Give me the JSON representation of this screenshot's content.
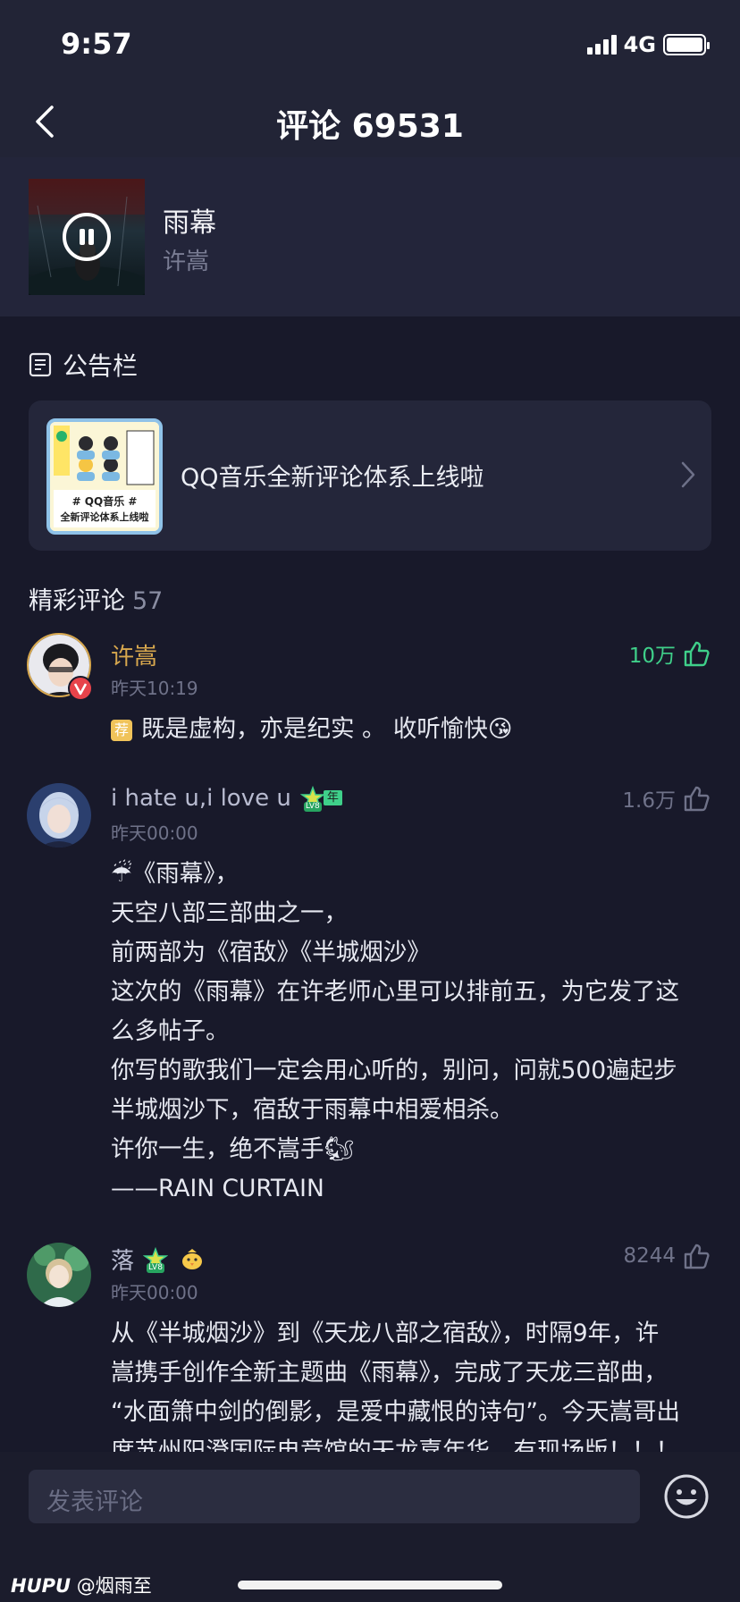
{
  "status_bar": {
    "time": "9:57",
    "network": "4G",
    "battery_level": 1.0
  },
  "nav": {
    "title": "评论 69531"
  },
  "song": {
    "title": "雨幕",
    "artist": "许嵩",
    "is_playing": true
  },
  "notice": {
    "heading": "公告栏",
    "card_text": "QQ音乐全新评论体系上线啦",
    "thumb_caption_1": "# QQ音乐 #",
    "thumb_caption_2": "全新评论体系上线啦"
  },
  "section": {
    "title": "精彩评论",
    "count": "57"
  },
  "comments": [
    {
      "author": "许嵩",
      "time": "昨天10:19",
      "likes": "10万",
      "liked": true,
      "verified_badge": "V",
      "tag": "荐",
      "lines": [
        "既是虚构，亦是纪实 。 收听愉快😘"
      ]
    },
    {
      "author": "i hate u,i love u",
      "level_badge": "LV8",
      "year_badge": "年",
      "time": "昨天00:00",
      "likes": "1.6万",
      "liked": false,
      "lines": [
        "☔《雨幕》，",
        "天空八部三部曲之一，",
        "前两部为《宿敌》《半城烟沙》",
        "这次的《雨幕》在许老师心里可以排前五，为它发了这",
        "么多帖子。",
        "你写的歌我们一定会用心听的，别问，问就500遍起步",
        "半城烟沙下，宿敌于雨幕中相爱相杀。",
        "许你一生，绝不嵩手🐿",
        "——RAIN CURTAIN"
      ]
    },
    {
      "author": "落",
      "level_badge": "LV8",
      "time": "昨天00:00",
      "likes": "8244",
      "liked": false,
      "lines": [
        "从《半城烟沙》到《天龙八部之宿敌》，时隔9年，许",
        "嵩携手创作全新主题曲《雨幕》，完成了天龙三部曲，",
        "“水面箫中剑的倒影，是爱中藏恨的诗句”。今天嵩哥出",
        "席苏州阳澄国际电竞馆的天龙嘉年华，有现场版！！！"
      ]
    }
  ],
  "input": {
    "placeholder": "发表评论"
  },
  "watermark": {
    "logo": "HUPU",
    "user": "@烟雨至"
  },
  "colors": {
    "background": "#18192a",
    "accent_green": "#3fd08a",
    "author_gold": "#d8a84e"
  }
}
